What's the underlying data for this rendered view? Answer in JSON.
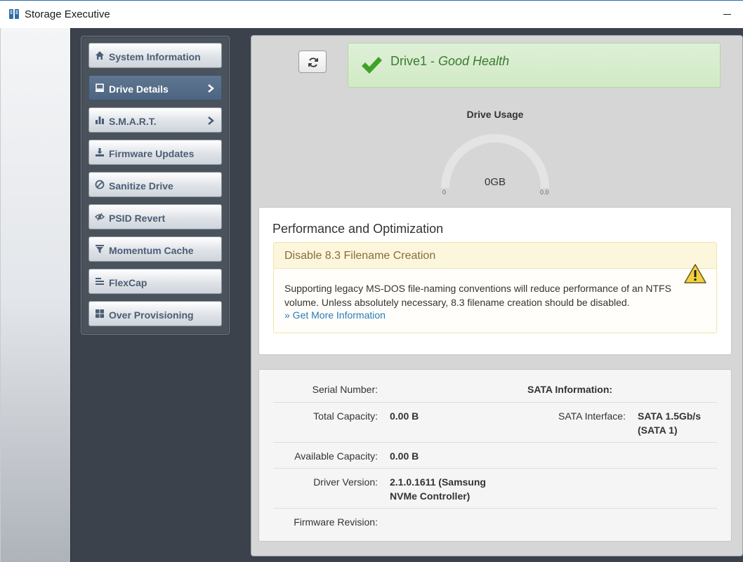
{
  "window": {
    "title": "Storage Executive"
  },
  "sidebar": {
    "items": [
      {
        "label": "System Information",
        "icon": "home-icon",
        "active": false,
        "has_chevron": false
      },
      {
        "label": "Drive Details",
        "icon": "drive-icon",
        "active": true,
        "has_chevron": true
      },
      {
        "label": "S.M.A.R.T.",
        "icon": "bar-chart-icon",
        "active": false,
        "has_chevron": true
      },
      {
        "label": "Firmware Updates",
        "icon": "download-icon",
        "active": false,
        "has_chevron": false
      },
      {
        "label": "Sanitize Drive",
        "icon": "ban-icon",
        "active": false,
        "has_chevron": false
      },
      {
        "label": "PSID Revert",
        "icon": "eye-slash-icon",
        "active": false,
        "has_chevron": false
      },
      {
        "label": "Momentum Cache",
        "icon": "filter-icon",
        "active": false,
        "has_chevron": false
      },
      {
        "label": "FlexCap",
        "icon": "align-left-icon",
        "active": false,
        "has_chevron": false
      },
      {
        "label": "Over Provisioning",
        "icon": "grid-icon",
        "active": false,
        "has_chevron": false
      }
    ]
  },
  "health": {
    "drive": "Drive1",
    "separator": " - ",
    "status": "Good Health"
  },
  "usage": {
    "title": "Drive Usage",
    "value": "0GB",
    "min_label": "0",
    "max_label": "0.0",
    "fraction": 0
  },
  "performance": {
    "title": "Performance and Optimization",
    "warning_title": "Disable 8.3 Filename Creation",
    "warning_text": "Supporting legacy MS-DOS file-naming conventions will reduce performance of an NTFS volume. Unless absolutely necessary, 8.3 filename creation should be disabled.",
    "link_text": "» Get More Information"
  },
  "info": {
    "serial_label": "Serial Number:",
    "serial_value": "",
    "sata_heading": "SATA Information:",
    "total_label": "Total Capacity:",
    "total_value": "0.00 B",
    "sata_interface_label": "SATA Interface:",
    "sata_interface_value": "SATA 1.5Gb/s (SATA 1)",
    "available_label": "Available Capacity:",
    "available_value": "0.00 B",
    "driver_label": "Driver Version:",
    "driver_value": "2.1.0.1611 (Samsung NVMe Controller)",
    "firmware_label": "Firmware Revision:",
    "firmware_value": ""
  },
  "colors": {
    "accent_active": "#536b86",
    "health_green": "#3c7a32",
    "warning_text": "#8a6d3b",
    "link_blue": "#2a7ab8"
  }
}
